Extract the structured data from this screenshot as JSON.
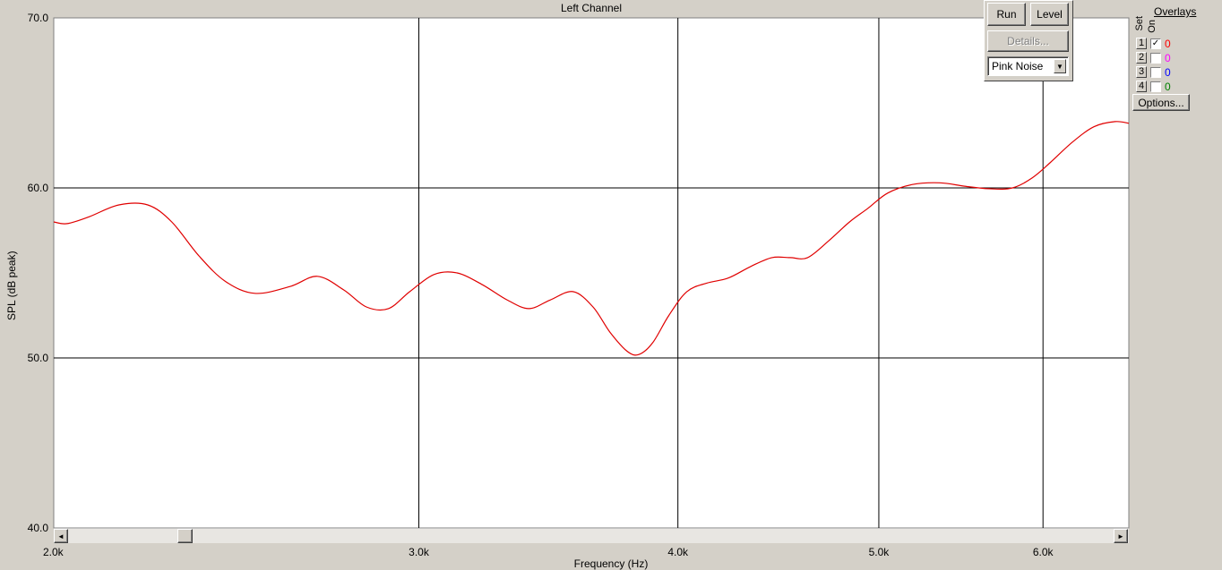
{
  "window": {
    "title": "Left Channel"
  },
  "toolbar": {
    "run_label": "Run",
    "level_label": "Level",
    "details_label": "Details...",
    "signal_select": {
      "value": "Pink Noise",
      "options": [
        "Pink Noise"
      ]
    }
  },
  "overlays": {
    "title": "Overlays",
    "set_header": "Set",
    "on_header": "On",
    "rows": [
      {
        "set": "1",
        "checked": true,
        "count": "0",
        "color": "#ff0000"
      },
      {
        "set": "2",
        "checked": false,
        "count": "0",
        "color": "#ff00ff"
      },
      {
        "set": "3",
        "checked": false,
        "count": "0",
        "color": "#0000ff"
      },
      {
        "set": "4",
        "checked": false,
        "count": "0",
        "color": "#008000"
      }
    ],
    "options_label": "Options..."
  },
  "scrollbar": {
    "left_arrow": "◄",
    "right_arrow": "►"
  },
  "chart_data": {
    "type": "line",
    "title": "Left Channel",
    "xlabel": "Frequency (Hz)",
    "ylabel": "SPL (dB peak)",
    "xscale": "log",
    "xlim": [
      2000,
      6600
    ],
    "ylim": [
      40,
      70
    ],
    "grid": true,
    "xticks": [
      {
        "value": 2000,
        "label": "2.0k"
      },
      {
        "value": 3000,
        "label": "3.0k"
      },
      {
        "value": 4000,
        "label": "4.0k"
      },
      {
        "value": 5000,
        "label": "5.0k"
      },
      {
        "value": 6000,
        "label": "6.0k"
      }
    ],
    "yticks": [
      {
        "value": 40,
        "label": "40.0"
      },
      {
        "value": 50,
        "label": "50.0"
      },
      {
        "value": 60,
        "label": "60.0"
      },
      {
        "value": 70,
        "label": "70.0"
      }
    ],
    "series": [
      {
        "color": "#e00000",
        "x": [
          2000,
          2030,
          2080,
          2150,
          2220,
          2280,
          2350,
          2420,
          2500,
          2600,
          2680,
          2760,
          2830,
          2900,
          2970,
          3050,
          3130,
          3220,
          3310,
          3390,
          3470,
          3560,
          3640,
          3710,
          3780,
          3830,
          3890,
          3960,
          4040,
          4130,
          4230,
          4340,
          4440,
          4530,
          4620,
          4730,
          4840,
          4940,
          5050,
          5190,
          5350,
          5500,
          5650,
          5800,
          5930,
          6050,
          6200,
          6350,
          6500,
          6600
        ],
        "y": [
          58.0,
          57.9,
          58.3,
          59.0,
          59.0,
          58.0,
          56.0,
          54.5,
          53.8,
          54.2,
          54.8,
          54.0,
          53.0,
          52.9,
          53.9,
          54.9,
          55.0,
          54.3,
          53.4,
          52.9,
          53.4,
          53.9,
          53.0,
          51.5,
          50.4,
          50.2,
          50.9,
          52.5,
          53.9,
          54.4,
          54.7,
          55.4,
          55.9,
          55.9,
          55.9,
          56.9,
          58.0,
          58.8,
          59.7,
          60.2,
          60.3,
          60.1,
          59.95,
          60.0,
          60.6,
          61.5,
          62.7,
          63.6,
          63.9,
          63.8
        ]
      }
    ]
  }
}
